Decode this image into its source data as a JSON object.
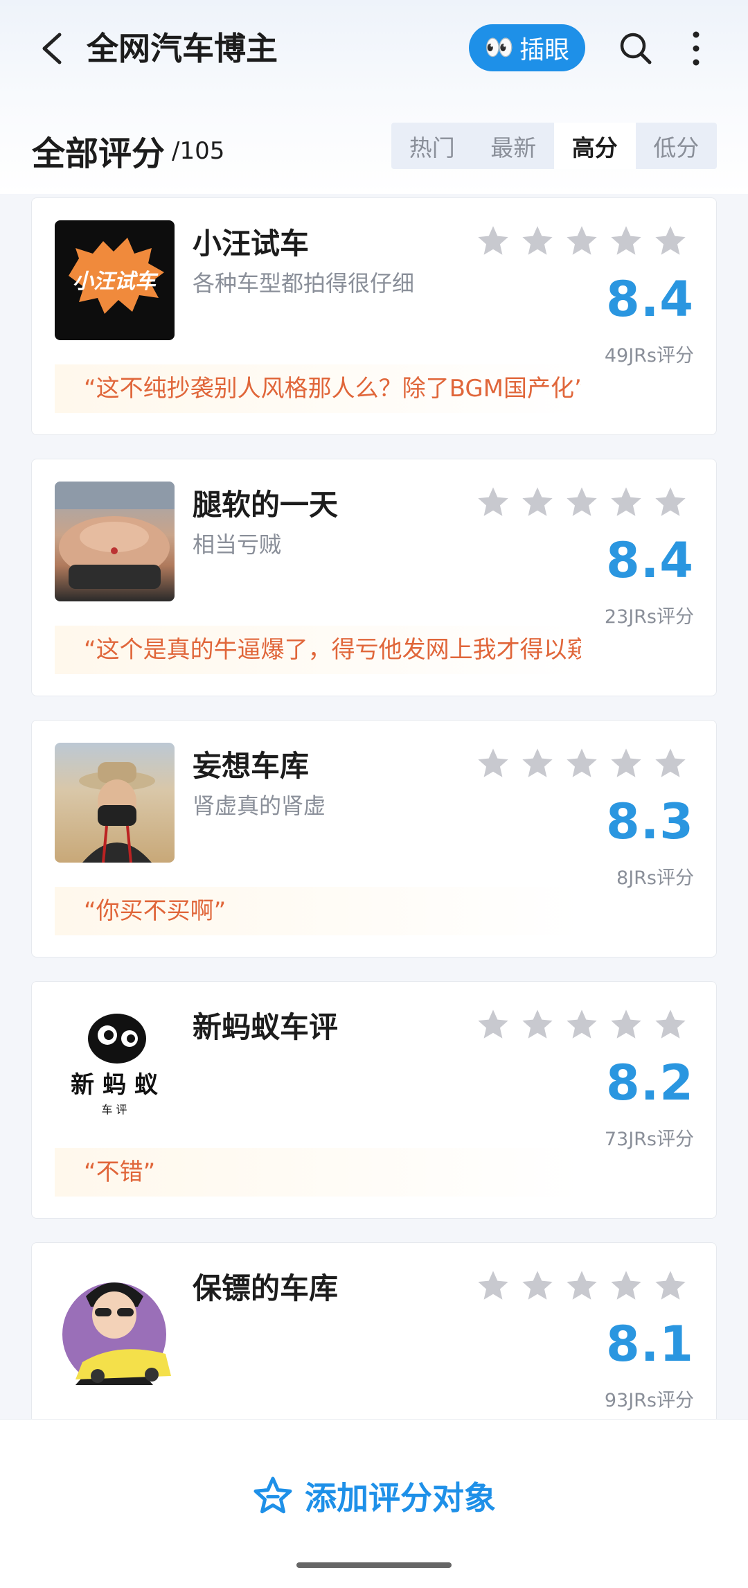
{
  "header": {
    "title": "全网汽车博主",
    "peek_button": "插眼",
    "peek_emoji": "👀"
  },
  "section": {
    "title": "全部评分",
    "count": "/105"
  },
  "sort_tabs": [
    {
      "label": "热门",
      "active": false
    },
    {
      "label": "最新",
      "active": false
    },
    {
      "label": "高分",
      "active": true
    },
    {
      "label": "低分",
      "active": false
    }
  ],
  "items": [
    {
      "name": "小汪试车",
      "desc": "各种车型都拍得很仔细",
      "score": "8.4",
      "raters": "49JRs评分",
      "stars": 5,
      "quote": "“这不纯抄袭别人风格那人么？除了BGM国产化”",
      "thumb_text": "小汪试车"
    },
    {
      "name": "腿软的一天",
      "desc": "相当亏贼",
      "score": "8.4",
      "raters": "23JRs评分",
      "stars": 5,
      "quote": "“这个是真的牛逼爆了，得亏他发网上我才得以窥... ”"
    },
    {
      "name": "妄想车库",
      "desc": "肾虚真的肾虚",
      "score": "8.3",
      "raters": "8JRs评分",
      "stars": 5,
      "quote": "“你买不买啊”"
    },
    {
      "name": "新蚂蚁车评",
      "desc": "",
      "score": "8.2",
      "raters": "73JRs评分",
      "stars": 5,
      "quote": "“不错”",
      "thumb_text": "新 蚂 蚁",
      "thumb_sub": "车 评"
    },
    {
      "name": "保镖的车库",
      "desc": "",
      "score": "8.1",
      "raters": "93JRs评分",
      "stars": 5,
      "quote": ""
    }
  ],
  "bottom": {
    "add_label": "添加评分对象"
  },
  "colors": {
    "accent": "#1e90e8",
    "score": "#2a96e0",
    "quote": "#e0663a",
    "star_empty": "#c8c9cf"
  }
}
